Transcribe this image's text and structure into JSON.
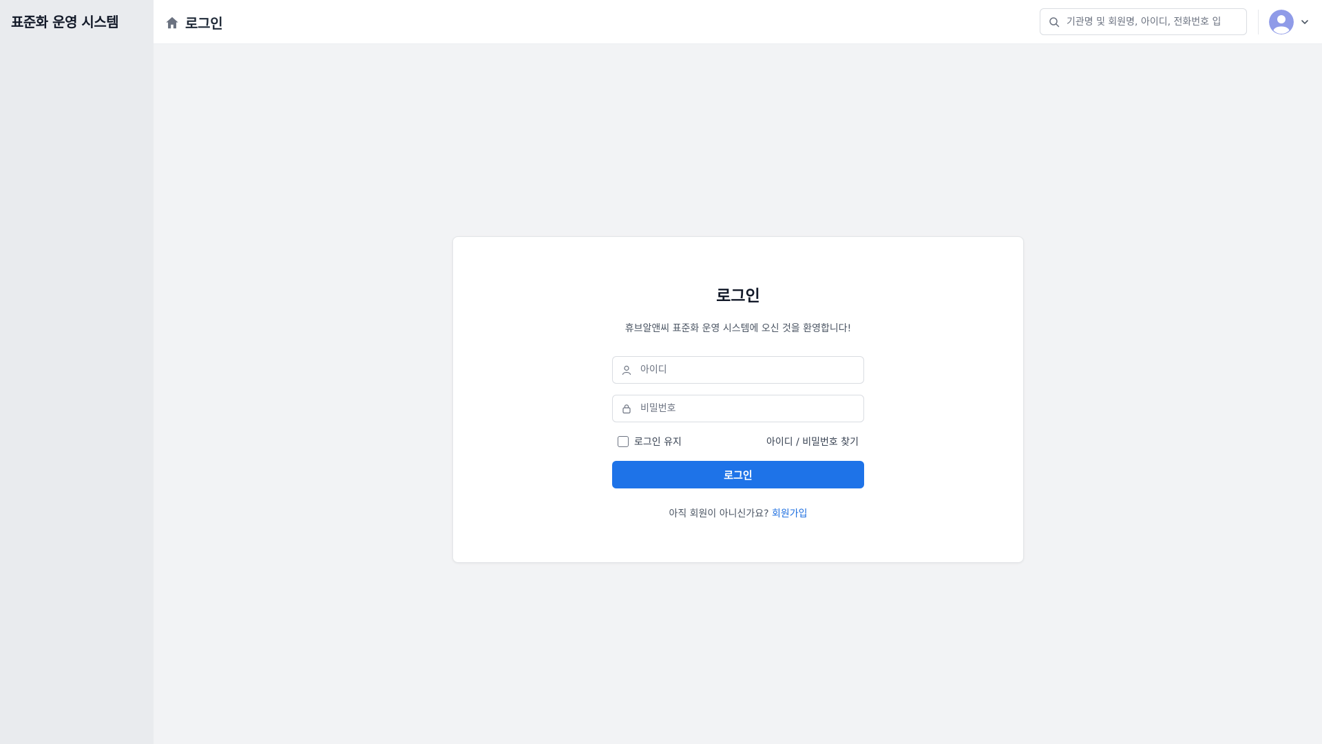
{
  "sidebar": {
    "brand": "표준화 운영 시스템"
  },
  "header": {
    "home_icon": "home-icon",
    "title": "로그인",
    "search_placeholder": "기관명 및 회원명, 아이디, 전화번호 입",
    "search_icon": "search-icon",
    "avatar_icon": "user-avatar-icon",
    "menu_icon": "chevron-down-icon"
  },
  "login": {
    "title": "로그인",
    "subtitle": "휴브알앤씨 표준화 운영 시스템에 오신 것을 환영합니다!",
    "id_placeholder": "아이디",
    "id_icon": "user-icon",
    "password_placeholder": "비밀번호",
    "password_icon": "lock-icon",
    "remember_label": "로그인 유지",
    "remember_checked": false,
    "find_link": "아이디 / 비밀번호 찾기",
    "submit_label": "로그인",
    "signup_prompt": "아직 회원이 아니신가요?",
    "signup_link": "회원가입"
  },
  "colors": {
    "primary": "#1e73e8",
    "link": "#1e6fe0",
    "sidebar_bg": "#e9ebee",
    "page_bg": "#f2f3f5",
    "avatar": "#8f9be8"
  }
}
